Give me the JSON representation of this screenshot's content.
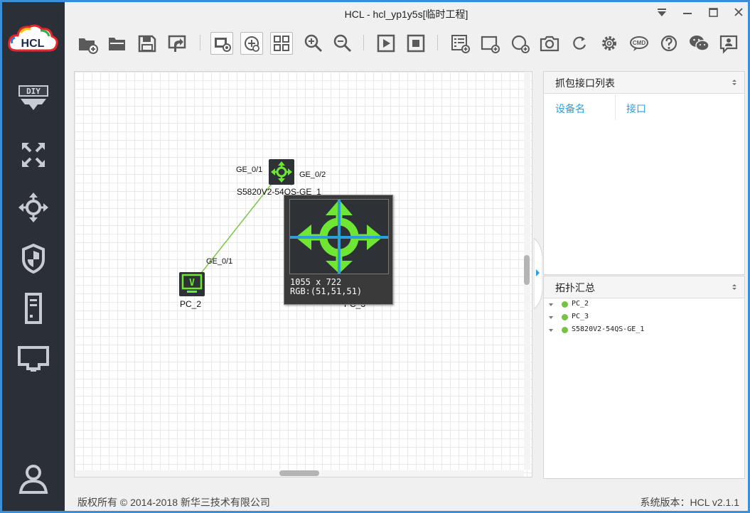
{
  "app": {
    "title": "HCL - hcl_yp1y5s[临时工程]",
    "logo_text": "HCL"
  },
  "sidebar": {
    "items": [
      {
        "name": "diy",
        "icon": "diy-icon",
        "label": "DIY"
      },
      {
        "name": "expand",
        "icon": "expand-arrows-icon"
      },
      {
        "name": "router",
        "icon": "router-icon"
      },
      {
        "name": "firewall",
        "icon": "shield-icon"
      },
      {
        "name": "server",
        "icon": "server-icon"
      },
      {
        "name": "terminal",
        "icon": "monitor-icon"
      },
      {
        "name": "user",
        "icon": "user-icon"
      }
    ]
  },
  "toolbar": {
    "buttons": [
      "new-project-icon",
      "open-project-icon",
      "save-icon",
      "export-icon",
      "screenshot-view-icon",
      "topology-view-icon",
      "grid-view-icon",
      "zoom-in-icon",
      "zoom-out-icon",
      "start-icon",
      "stop-icon",
      "capture-list-icon",
      "add-note-icon",
      "add-shape-icon",
      "camera-icon",
      "refresh-icon",
      "settings-icon",
      "cmd-icon",
      "help-icon",
      "wechat-icon",
      "feedback-icon"
    ],
    "cmd_label": "CMD"
  },
  "canvas": {
    "devices": [
      {
        "id": "switch",
        "label": "S5820V2-54QS-GE_1",
        "type": "switch",
        "icon": "switch-icon"
      },
      {
        "id": "pc2",
        "label": "PC_2",
        "type": "pc",
        "icon": "pc-icon"
      },
      {
        "id": "pc3",
        "label": "PC_3",
        "type": "pc",
        "icon": "pc-icon"
      }
    ],
    "ports": {
      "sw_p1": "GE_0/1",
      "sw_p2": "GE_0/2",
      "pc2_p1": "GE_0/1"
    },
    "pc_glyph": "V"
  },
  "magnifier": {
    "size_text": "1055 x 722",
    "rgb_text": "RGB:(51,51,51)"
  },
  "capture_panel": {
    "title": "抓包接口列表",
    "columns": [
      "设备名",
      "接口"
    ]
  },
  "topology_panel": {
    "title": "拓扑汇总",
    "items": [
      "PC_2",
      "PC_3",
      "S5820V2-54QS-GE_1"
    ]
  },
  "status": {
    "copyright": "版权所有 © 2014-2018 新华三技术有限公司",
    "version": "系统版本：HCL v2.1.1"
  },
  "colors": {
    "sidebar_bg": "#2b3038",
    "window_border": "#3b8fd6",
    "link_green": "#79c144",
    "device_green": "#6ee633",
    "column_blue": "#2b9fd8"
  }
}
